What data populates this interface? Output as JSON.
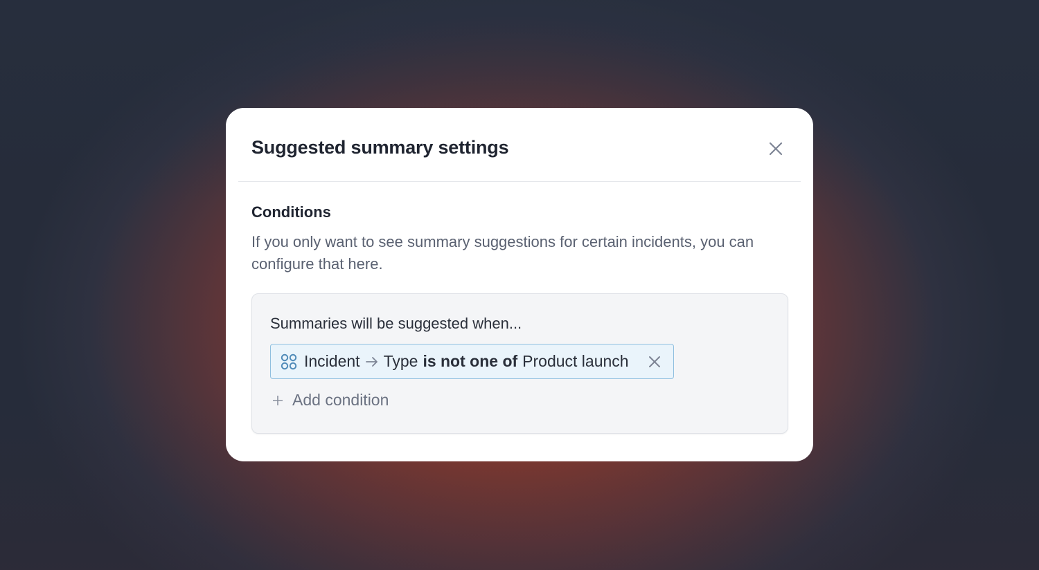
{
  "modal": {
    "title": "Suggested summary settings",
    "close_icon": "close-icon"
  },
  "conditions": {
    "title": "Conditions",
    "description": "If you only want to see summary suggestions for certain incidents, you can configure that here.",
    "box_heading": "Summaries will be suggested when...",
    "condition": {
      "icon": "grid-icon",
      "subject": "Incident",
      "field": "Type",
      "operator": "is not one of",
      "value": "Product launch",
      "remove_icon": "close-icon"
    },
    "add_label": "Add condition"
  },
  "colors": {
    "pill_background": "#eaf4fb",
    "pill_border": "#8fbfdf",
    "grid_icon": "#4f8ab8"
  }
}
